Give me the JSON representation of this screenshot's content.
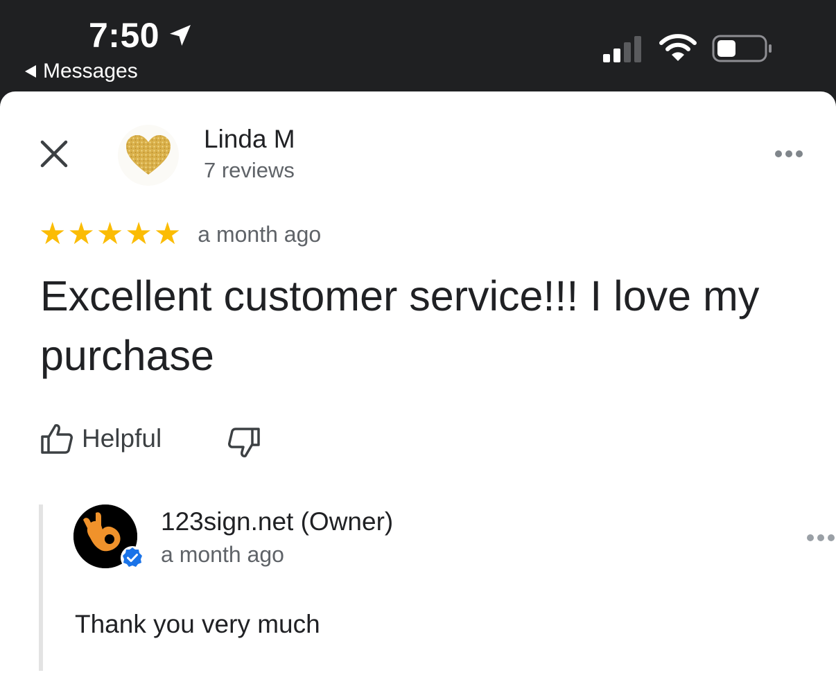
{
  "status_bar": {
    "time": "7:50",
    "back_label": "Messages",
    "icons": [
      "location-arrow-icon",
      "cellular-signal-icon",
      "wifi-icon",
      "battery-icon"
    ]
  },
  "review": {
    "reviewer_name": "Linda M",
    "reviewer_reviews": "7 reviews",
    "rating": 5,
    "rating_max": 5,
    "date": "a month ago",
    "text": "Excellent customer service!!! I love my purchase",
    "helpful_label": "Helpful",
    "avatar_icon": "gold-glitter-heart-icon"
  },
  "owner_response": {
    "name": "123sign.net (Owner)",
    "date": "a month ago",
    "text": "Thank you very much",
    "avatar_icon": "ok-hand-icon",
    "badge_icon": "verified-badge-icon"
  },
  "colors": {
    "status_bar_bg": "#1f2022",
    "star": "#fbbc04",
    "secondary_text": "#5f6368",
    "owner_logo_orange": "#f0922b",
    "verified_blue": "#1a73e8"
  }
}
